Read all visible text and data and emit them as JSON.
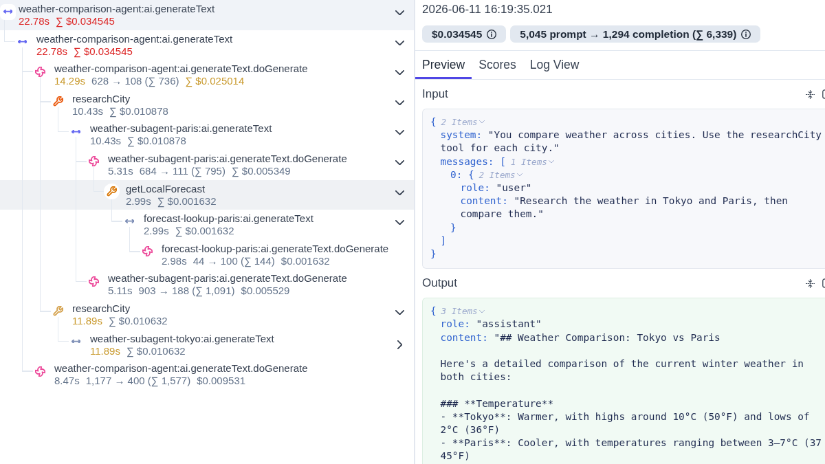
{
  "trace": [
    {
      "kind": "agent",
      "name": "weather-comparison-agent:ai.generateText",
      "color": "#6366f1",
      "selected": true,
      "highlighted": false,
      "expanded": true,
      "duration": {
        "text": "22.78s",
        "color": "#dc2626"
      },
      "cost": {
        "text": "∑ $0.034545",
        "color": "#dc2626"
      },
      "children": [
        {
          "kind": "agent",
          "name": "weather-comparison-agent:ai.generateText",
          "color": "#6366f1",
          "selected": false,
          "highlighted": false,
          "expanded": true,
          "duration": {
            "text": "22.78s",
            "color": "#dc2626"
          },
          "cost": {
            "text": "∑ $0.034545",
            "color": "#dc2626"
          },
          "children": [
            {
              "kind": "generation",
              "name": "weather-comparison-agent:ai.generateText.doGenerate",
              "color": "#ec4899",
              "selected": false,
              "highlighted": false,
              "expanded": true,
              "duration": {
                "text": "14.29s",
                "color": "#c99a2e"
              },
              "tokens": "628 → 108 (∑ 736)",
              "cost": {
                "text": "∑ $0.025014",
                "color": "#c99a2e"
              },
              "children": [
                {
                  "kind": "tool",
                  "name": "researchCity",
                  "color": "#ea580c",
                  "selected": false,
                  "highlighted": false,
                  "expanded": true,
                  "duration": {
                    "text": "10.43s",
                    "color": "#64748b"
                  },
                  "cost": {
                    "text": "∑ $0.010878",
                    "color": "#64748b"
                  },
                  "children": [
                    {
                      "kind": "agent",
                      "name": "weather-subagent-paris:ai.generateText",
                      "color": "#6366f1",
                      "selected": false,
                      "highlighted": false,
                      "expanded": true,
                      "duration": {
                        "text": "10.43s",
                        "color": "#64748b"
                      },
                      "cost": {
                        "text": "∑ $0.010878",
                        "color": "#64748b"
                      },
                      "children": [
                        {
                          "kind": "generation",
                          "name": "weather-subagent-paris:ai.generateText.doGenerate",
                          "color": "#ec4899",
                          "selected": false,
                          "highlighted": false,
                          "expanded": true,
                          "duration": {
                            "text": "5.31s",
                            "color": "#64748b"
                          },
                          "tokens": "684 → 111 (∑ 795)",
                          "cost": {
                            "text": "∑ $0.005349",
                            "color": "#64748b"
                          },
                          "children": [
                            {
                              "kind": "tool",
                              "name": "getLocalForecast",
                              "color": "#d97706",
                              "selected": false,
                              "highlighted": true,
                              "expanded": true,
                              "duration": {
                                "text": "2.99s",
                                "color": "#64748b"
                              },
                              "cost": {
                                "text": "∑ $0.001632",
                                "color": "#64748b"
                              },
                              "children": [
                                {
                                  "kind": "agent",
                                  "name": "forecast-lookup-paris:ai.generateText",
                                  "color": "#7c8db5",
                                  "selected": false,
                                  "highlighted": false,
                                  "expanded": true,
                                  "duration": {
                                    "text": "2.99s",
                                    "color": "#64748b"
                                  },
                                  "cost": {
                                    "text": "∑ $0.001632",
                                    "color": "#64748b"
                                  },
                                  "children": [
                                    {
                                      "kind": "generation",
                                      "name": "forecast-lookup-paris:ai.generateText.doGenerate",
                                      "color": "#ec4899",
                                      "selected": false,
                                      "highlighted": false,
                                      "duration": {
                                        "text": "2.98s",
                                        "color": "#64748b"
                                      },
                                      "tokens": "44 → 100 (∑ 144)",
                                      "cost": {
                                        "text": "$0.001632",
                                        "color": "#64748b"
                                      }
                                    }
                                  ]
                                }
                              ]
                            }
                          ]
                        },
                        {
                          "kind": "generation",
                          "name": "weather-subagent-paris:ai.generateText.doGenerate",
                          "color": "#ec4899",
                          "selected": false,
                          "highlighted": false,
                          "duration": {
                            "text": "5.11s",
                            "color": "#64748b"
                          },
                          "tokens": "903 → 188 (∑ 1,091)",
                          "cost": {
                            "text": "$0.005529",
                            "color": "#64748b"
                          }
                        }
                      ]
                    }
                  ]
                },
                {
                  "kind": "tool",
                  "name": "researchCity",
                  "color": "#d4a04a",
                  "selected": false,
                  "highlighted": false,
                  "expanded": true,
                  "duration": {
                    "text": "11.89s",
                    "color": "#c99a2e"
                  },
                  "cost": {
                    "text": "∑ $0.010632",
                    "color": "#64748b"
                  },
                  "children": [
                    {
                      "kind": "agent",
                      "name": "weather-subagent-tokyo:ai.generateText",
                      "color": "#7c8db5",
                      "selected": false,
                      "highlighted": false,
                      "expanded": false,
                      "duration": {
                        "text": "11.89s",
                        "color": "#c99a2e"
                      },
                      "cost": {
                        "text": "∑ $0.010632",
                        "color": "#64748b"
                      }
                    }
                  ]
                }
              ]
            },
            {
              "kind": "generation",
              "name": "weather-comparison-agent:ai.generateText.doGenerate",
              "color": "#ec4899",
              "selected": false,
              "highlighted": false,
              "duration": {
                "text": "8.47s",
                "color": "#64748b"
              },
              "tokens": "1,177 → 400 (∑ 1,577)",
              "cost": {
                "text": "$0.009531",
                "color": "#64748b"
              }
            }
          ]
        }
      ]
    }
  ],
  "detail": {
    "timestamp": "2026-06-11 16:19:35.021",
    "summary": {
      "cost": "$0.034545",
      "tokens": "5,045 prompt → 1,294 completion (∑ 6,339)"
    },
    "tabs": [
      {
        "label": "Preview",
        "selected": true
      },
      {
        "label": "Scores",
        "selected": false
      },
      {
        "label": "Log View",
        "selected": false
      }
    ],
    "sections": [
      {
        "kind": "input",
        "title": "Input",
        "body": {
          "kind": "object",
          "open": "{",
          "count": "2 Items",
          "expanded": true,
          "close": "}",
          "children": [
            {
              "kind": "string",
              "key": "system:",
              "paragraphs": [
                [
                  "\"You compare weather across cities. Use the researchCity",
                  "tool for each city.\""
                ]
              ]
            },
            {
              "kind": "array",
              "key": "messages:",
              "open": "[",
              "count": "1 Items",
              "expanded": true,
              "close": "]",
              "children": [
                {
                  "kind": "object",
                  "key": "0:",
                  "open": "{",
                  "count": "2 Items",
                  "expanded": true,
                  "close": "}",
                  "children": [
                    {
                      "kind": "string",
                      "key": "role:",
                      "paragraphs": [
                        [
                          "\"user\""
                        ]
                      ]
                    },
                    {
                      "kind": "string",
                      "key": "content:",
                      "paragraphs": [
                        [
                          "\"Research the weather in Tokyo and Paris, then",
                          "compare them.\""
                        ]
                      ]
                    }
                  ]
                }
              ]
            }
          ]
        }
      },
      {
        "kind": "output",
        "title": "Output",
        "body": {
          "kind": "object",
          "open": "{",
          "count": "3 Items",
          "expanded": true,
          "children": [
            {
              "kind": "string",
              "key": "role:",
              "paragraphs": [
                [
                  "\"assistant\""
                ]
              ]
            },
            {
              "kind": "string",
              "key": "content:",
              "paragraphs": [
                [
                  "\"## Weather Comparison: Tokyo vs Paris"
                ],
                [
                  "Here's a detailed comparison of the current winter weather in",
                  "both cities:"
                ],
                [
                  "### **Temperature**",
                  "- **Tokyo**: Warmer, with highs around 10°C (50°F) and lows of",
                  "2°C (36°F)",
                  "- **Paris**: Cooler, with temperatures ranging between 3–7°C (37",
                  "45°F)"
                ]
              ]
            }
          ]
        }
      }
    ]
  }
}
